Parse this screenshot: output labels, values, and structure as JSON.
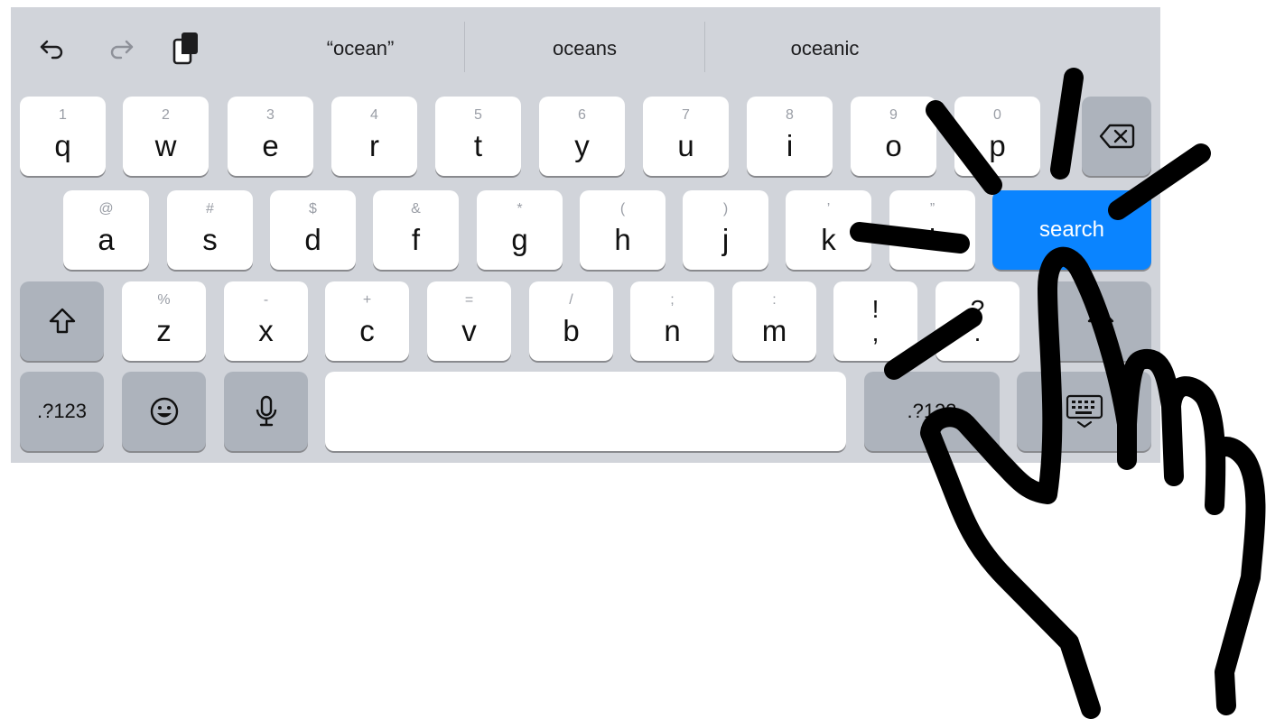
{
  "toolbar": {
    "undo_icon": "undo-arrow-icon",
    "redo_icon": "redo-arrow-icon",
    "clipboard_icon": "clipboard-icon",
    "suggestions": [
      "“ocean”",
      "oceans",
      "oceanic"
    ]
  },
  "rows": {
    "row1": [
      {
        "hint": "1",
        "main": "q"
      },
      {
        "hint": "2",
        "main": "w"
      },
      {
        "hint": "3",
        "main": "e"
      },
      {
        "hint": "4",
        "main": "r"
      },
      {
        "hint": "5",
        "main": "t"
      },
      {
        "hint": "6",
        "main": "y"
      },
      {
        "hint": "7",
        "main": "u"
      },
      {
        "hint": "8",
        "main": "i"
      },
      {
        "hint": "9",
        "main": "o"
      },
      {
        "hint": "0",
        "main": "p"
      }
    ],
    "row2": [
      {
        "hint": "@",
        "main": "a"
      },
      {
        "hint": "#",
        "main": "s"
      },
      {
        "hint": "$",
        "main": "d"
      },
      {
        "hint": "&",
        "main": "f"
      },
      {
        "hint": "*",
        "main": "g"
      },
      {
        "hint": "(",
        "main": "h"
      },
      {
        "hint": ")",
        "main": "j"
      },
      {
        "hint": "’",
        "main": "k"
      },
      {
        "hint": "”",
        "main": "l"
      }
    ],
    "row3": [
      {
        "hint": "%",
        "main": "z"
      },
      {
        "hint": "-",
        "main": "x"
      },
      {
        "hint": "+",
        "main": "c"
      },
      {
        "hint": "=",
        "main": "v"
      },
      {
        "hint": "/",
        "main": "b"
      },
      {
        "hint": ";",
        "main": "n"
      },
      {
        "hint": ":",
        "main": "m"
      }
    ]
  },
  "punct": {
    "excl_top": "!",
    "excl_bottom": ",",
    "q_top": "?",
    "q_bottom": "."
  },
  "keys": {
    "search_label": "search",
    "numbers_left": ".?123",
    "numbers_right": ".?123",
    "delete_icon": "backspace-icon",
    "shift_icon": "shift-arrow-icon",
    "emoji_icon": "emoji-face-icon",
    "mic_icon": "microphone-icon",
    "dismiss_icon": "keyboard-dismiss-icon"
  },
  "overlay": {
    "icon": "tapping-hand-icon"
  },
  "colors": {
    "keyboard_bg": "#d1d4da",
    "key": "#ffffff",
    "special_key": "#adb3bc",
    "accent": "#0a84ff"
  }
}
